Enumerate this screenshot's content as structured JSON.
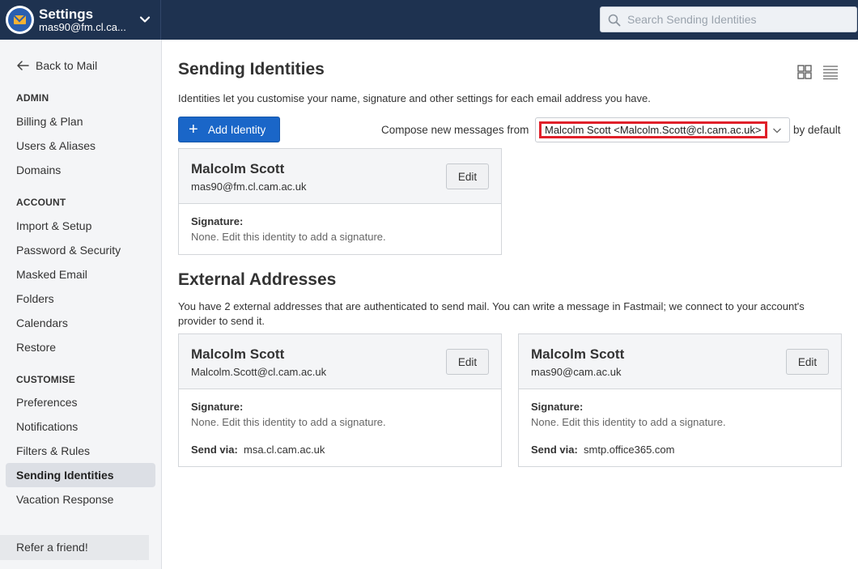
{
  "app": {
    "title": "Settings",
    "account": "mas90@fm.cl.ca...",
    "search_placeholder": "Search Sending Identities"
  },
  "sidebar": {
    "back_label": "Back to Mail",
    "sections": [
      {
        "heading": "ADMIN",
        "items": [
          "Billing & Plan",
          "Users & Aliases",
          "Domains"
        ]
      },
      {
        "heading": "ACCOUNT",
        "items": [
          "Import & Setup",
          "Password & Security",
          "Masked Email",
          "Folders",
          "Calendars",
          "Restore"
        ]
      },
      {
        "heading": "CUSTOMISE",
        "items": [
          "Preferences",
          "Notifications",
          "Filters & Rules",
          "Sending Identities",
          "Vacation Response"
        ]
      }
    ],
    "active_item": "Sending Identities",
    "refer_label": "Refer a friend!"
  },
  "main": {
    "title": "Sending Identities",
    "intro": "Identities let you customise your name, signature and other settings for each email address you have.",
    "add_button": "Add Identity",
    "compose_label": "Compose new messages from",
    "compose_value": "Malcolm Scott <Malcolm.Scott@cl.cam.ac.uk>",
    "compose_suffix": "by default",
    "identities": [
      {
        "name": "Malcolm Scott",
        "email": "mas90@fm.cl.cam.ac.uk",
        "edit": "Edit",
        "signature_label": "Signature:",
        "signature": "None. Edit this identity to add a signature."
      }
    ],
    "external_title": "External Addresses",
    "external_desc": "You have 2 external addresses that are authenticated to send mail. You can write a message in Fastmail; we connect to your account's provider to send it.",
    "external": [
      {
        "name": "Malcolm Scott",
        "email": "Malcolm.Scott@cl.cam.ac.uk",
        "edit": "Edit",
        "signature_label": "Signature:",
        "signature": "None. Edit this identity to add a signature.",
        "via_label": "Send via:",
        "via": "msa.cl.cam.ac.uk"
      },
      {
        "name": "Malcolm Scott",
        "email": "mas90@cam.ac.uk",
        "edit": "Edit",
        "signature_label": "Signature:",
        "signature": "None. Edit this identity to add a signature.",
        "via_label": "Send via:",
        "via": "smtp.office365.com"
      }
    ]
  },
  "colors": {
    "topbar": "#1e3250",
    "primary_button": "#1a66c8",
    "highlight_border": "#e0202a"
  }
}
